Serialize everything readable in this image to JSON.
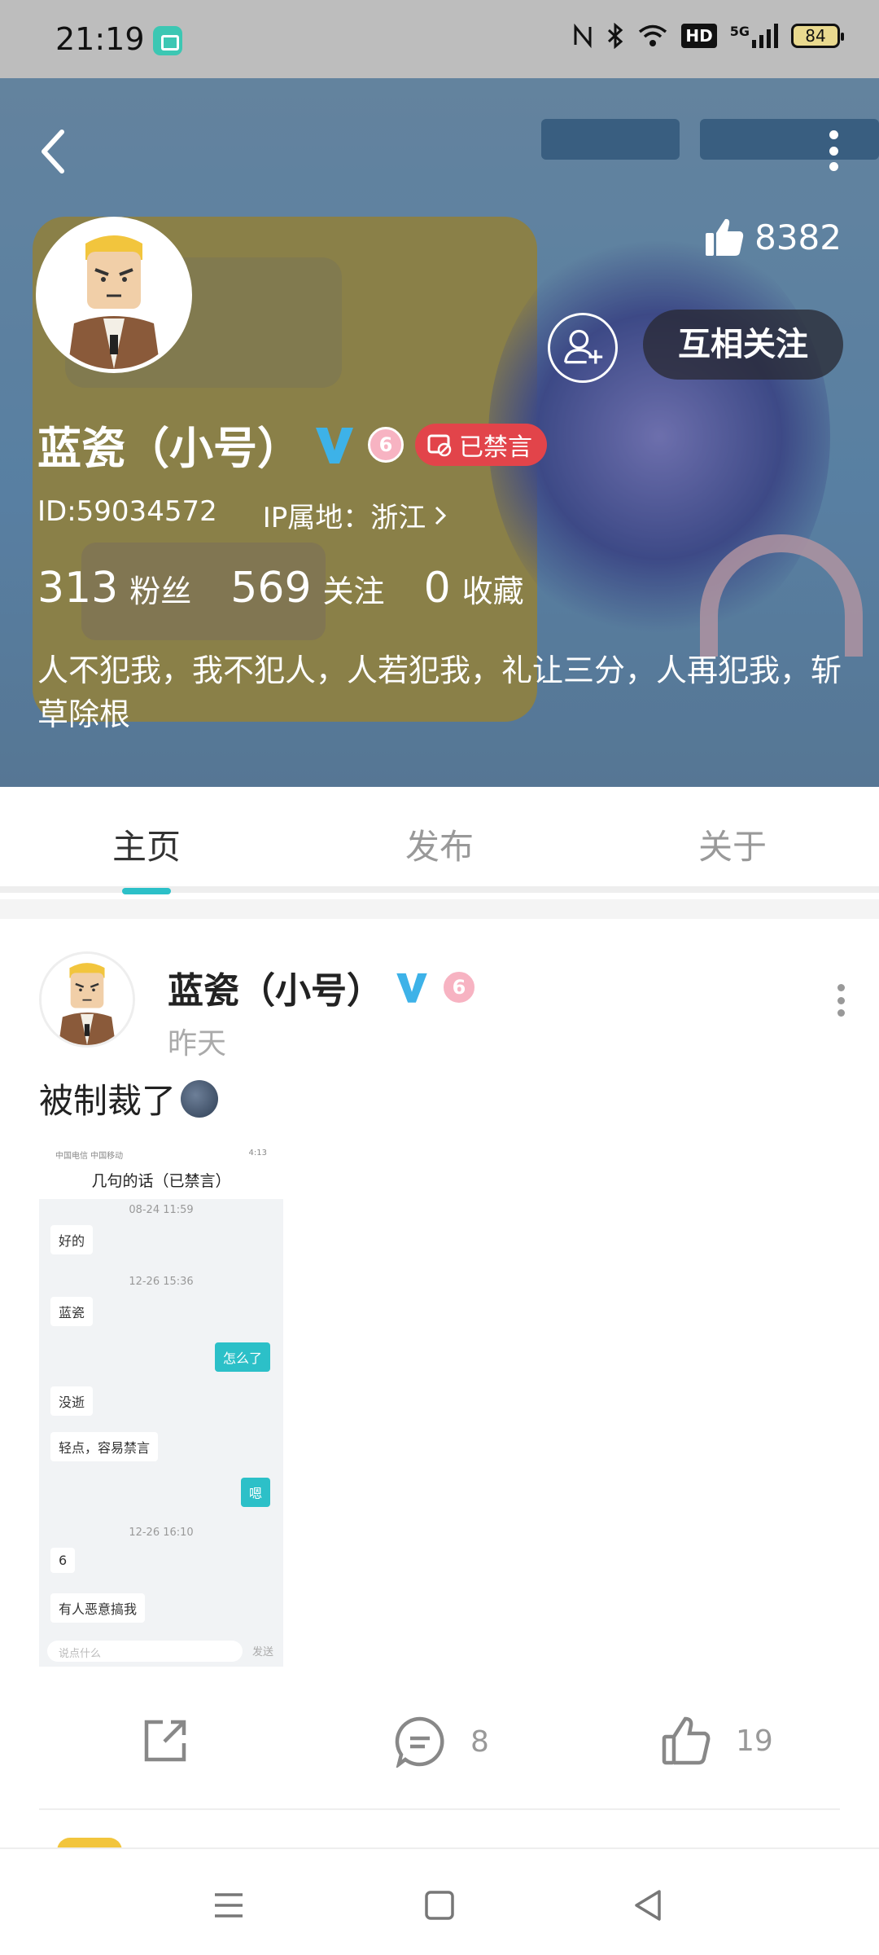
{
  "status_bar": {
    "time": "21:19",
    "network": "5G",
    "battery": "84",
    "hd_label": "HD"
  },
  "header": {
    "likes_count": "8382",
    "follow_button_label": "互相关注",
    "user_name": "蓝瓷（小号）",
    "level": "6",
    "banned_label": "已禁言",
    "user_id": "ID:59034572",
    "ip_location": "IP属地：浙江",
    "stats": {
      "followers_count": "313",
      "followers_label": "粉丝",
      "following_count": "569",
      "following_label": "关注",
      "favorites_count": "0",
      "favorites_label": "收藏"
    },
    "bio": "人不犯我，我不犯人，人若犯我，礼让三分，人再犯我，斩草除根",
    "icons": [
      "back-icon",
      "more-icon",
      "thumb-up-icon",
      "add-friend-icon",
      "verified-v-icon",
      "level-badge-icon",
      "banned-icon"
    ]
  },
  "tabs": [
    {
      "label": "主页",
      "active": true
    },
    {
      "label": "发布",
      "active": false
    },
    {
      "label": "关于",
      "active": false
    }
  ],
  "post": {
    "author": "蓝瓷（小号）",
    "level": "6",
    "time": "昨天",
    "text": "被制裁了",
    "image": {
      "status_left": "中国电信 中国移动",
      "status_right": "4:13",
      "title": "几句的话（已禁言）",
      "messages": [
        {
          "type": "time",
          "text": "08-24 11:59"
        },
        {
          "type": "left",
          "text": "好的"
        },
        {
          "type": "time",
          "text": "12-26 15:36"
        },
        {
          "type": "left",
          "text": "蓝瓷"
        },
        {
          "type": "right",
          "text": "怎么了"
        },
        {
          "type": "left",
          "text": "没逝"
        },
        {
          "type": "left",
          "text": "轻点，容易禁言"
        },
        {
          "type": "right",
          "text": "嗯"
        },
        {
          "type": "time",
          "text": "12-26 16:10"
        },
        {
          "type": "left",
          "text": "6"
        },
        {
          "type": "left",
          "text": "有人恶意搞我"
        }
      ],
      "input_placeholder": "说点什么",
      "send_label": "发送"
    },
    "comments_count": "8",
    "likes_count": "19"
  },
  "nav_bar": {
    "icons": [
      "menu-icon",
      "home-icon",
      "back-triangle-icon"
    ]
  },
  "colors": {
    "accent": "#2cc0c8",
    "banned": "#e2444a",
    "verified": "#3db2e8",
    "level": "#f7b3c2"
  }
}
